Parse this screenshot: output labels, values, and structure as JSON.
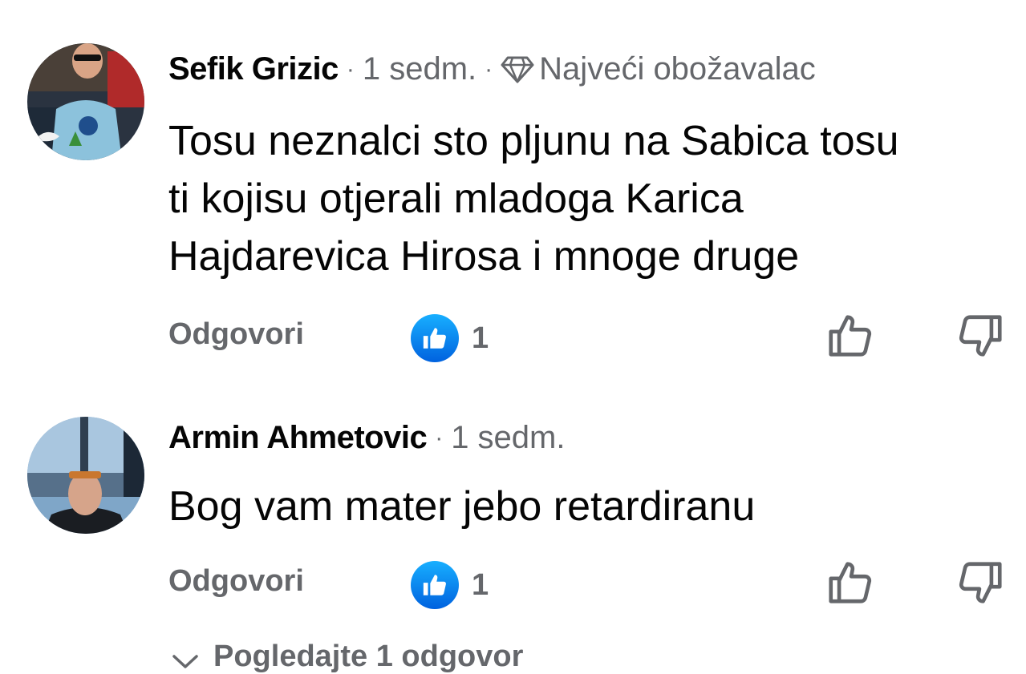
{
  "comments": [
    {
      "author": "Sefik Grizic",
      "time": "1 sedm.",
      "badge": "Najveći obožavalac",
      "badge_icon": "diamond-icon",
      "lines": [
        "Tosu neznalci sto pljunu na Sabica tosu",
        "ti kojisu otjerali mladoga Karica",
        "Hajdarevica Hirosa i mnoge druge"
      ],
      "reply_label": "Odgovori",
      "like_count": "1"
    },
    {
      "author": "Armin Ahmetovic",
      "time": "1 sedm.",
      "lines": [
        "Bog vam mater jebo retardiranu"
      ],
      "reply_label": "Odgovori",
      "like_count": "1"
    }
  ],
  "view_replies_label": "Pogledajte 1 odgovor",
  "colors": {
    "text": "#050505",
    "secondary": "#65676b",
    "like_blue_top": "#18afff",
    "like_blue_bottom": "#0062df"
  }
}
